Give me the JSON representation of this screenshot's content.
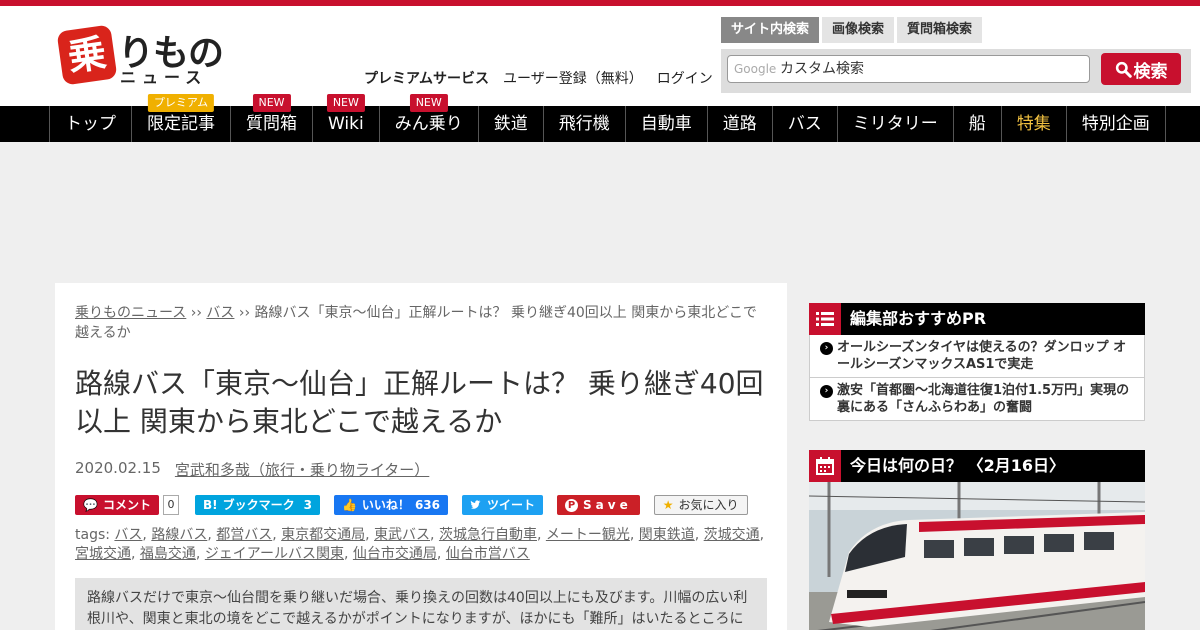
{
  "logo": {
    "badge": "乗",
    "rest": "りもの",
    "sub": "ニュース"
  },
  "header_links": {
    "premium": "プレミアムサービス",
    "register": "ユーザー登録（無料）",
    "login": "ログイン"
  },
  "search": {
    "tabs": [
      "サイト内検索",
      "画像検索",
      "質問箱検索"
    ],
    "google_label": "Google",
    "placeholder": "カスタム検索",
    "button": "検索"
  },
  "nav": [
    {
      "label": "トップ",
      "badge": ""
    },
    {
      "label": "限定記事",
      "badge": "プレミアム"
    },
    {
      "label": "質問箱",
      "badge": "NEW"
    },
    {
      "label": "Wiki",
      "badge": "NEW"
    },
    {
      "label": "みん乗り",
      "badge": "NEW"
    },
    {
      "label": "鉄道",
      "badge": ""
    },
    {
      "label": "飛行機",
      "badge": ""
    },
    {
      "label": "自動車",
      "badge": ""
    },
    {
      "label": "道路",
      "badge": ""
    },
    {
      "label": "バス",
      "badge": ""
    },
    {
      "label": "ミリタリー",
      "badge": ""
    },
    {
      "label": "船",
      "badge": ""
    },
    {
      "label": "特集",
      "badge": ""
    },
    {
      "label": "特別企画",
      "badge": ""
    }
  ],
  "breadcrumb": {
    "home": "乗りものニュース",
    "sep": " ›› ",
    "category": "バス",
    "current": "路線バス「東京～仙台」正解ルートは？ 乗り継ぎ40回以上 関東から東北どこで越えるか"
  },
  "article": {
    "title": "路線バス「東京～仙台」正解ルートは？ 乗り継ぎ40回以上 関東から東北どこで越えるか",
    "date": "2020.02.15",
    "author": "宮武和多哉（旅行・乗り物ライター）",
    "summary": "路線バスだけで東京～仙台間を乗り継いだ場合、乗り換えの回数は40回以上にも及びます。川幅の広い利根川や、関東と東北の境をどこで越えるかがポイントになりますが、ほかにも「難所」はいたるところにありました。"
  },
  "social": {
    "comment_label": "コメント",
    "comment_count": "0",
    "bookmark_label": "ブックマーク",
    "bookmark_count": "3",
    "like_label": "いいね！",
    "like_count": "636",
    "tweet_label": "ツイート",
    "save_label": "Save",
    "fav_label": "お気に入り"
  },
  "tags": {
    "label": "tags:",
    "items": [
      "バス",
      "路線バス",
      "都営バス",
      "東京都交通局",
      "東武バス",
      "茨城急行自動車",
      "メートー観光",
      "関東鉄道",
      "茨城交通",
      "宮城交通",
      "福島交通",
      "ジェイアールバス関東",
      "仙台市交通局",
      "仙台市営バス"
    ]
  },
  "sidebar": {
    "recommend_title": "編集部おすすめPR",
    "recommend_items": [
      "オールシーズンタイヤは使えるの？ダンロップ オールシーズンマックスAS1で実走",
      "激安「首都圏～北海道往復1泊付1.5万円」実現の裏にある「さんふらわあ」の奮闘"
    ],
    "today_title": "今日は何の日？ 〈2月16日〉"
  },
  "colors": {
    "brand_red": "#c8102e",
    "nav_bg": "#000000",
    "premium_gold": "#f0b000"
  }
}
